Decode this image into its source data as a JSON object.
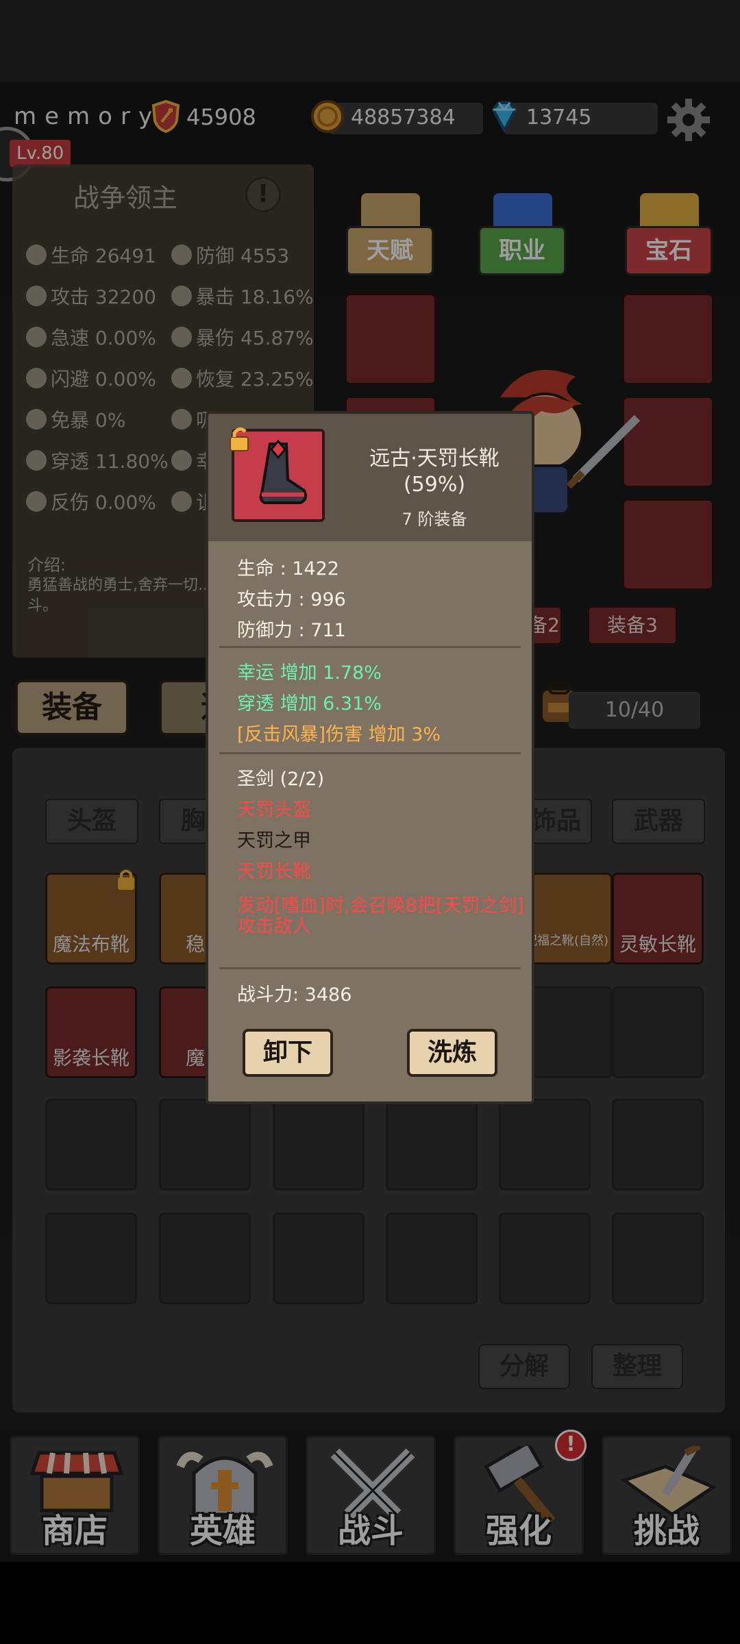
{
  "player": {
    "name": "memory",
    "rank_value": "45908",
    "level": "Lv.80",
    "gold": "48857384",
    "gems": "13745"
  },
  "stats_panel": {
    "title": "战争领主",
    "help_mark": "!",
    "left": [
      {
        "label": "生命",
        "value": "26491"
      },
      {
        "label": "攻击",
        "value": "32200"
      },
      {
        "label": "急速",
        "value": "0.00%"
      },
      {
        "label": "闪避",
        "value": "0.00%"
      },
      {
        "label": "免暴",
        "value": "0%"
      },
      {
        "label": "穿透",
        "value": "11.80%"
      },
      {
        "label": "反伤",
        "value": "0.00%"
      }
    ],
    "right": [
      {
        "label": "防御",
        "value": "4553"
      },
      {
        "label": "暴击",
        "value": "18.16%"
      },
      {
        "label": "暴伤",
        "value": "45.87%"
      },
      {
        "label": "恢复",
        "value": "23.25%"
      },
      {
        "label": "吸",
        "value": ""
      },
      {
        "label": "幸",
        "value": ""
      },
      {
        "label": "诅",
        "value": ""
      }
    ],
    "intro_label": "介绍:",
    "intro_text": "勇猛善战的勇士,舍弃一切... 大的敌人战斗。"
  },
  "category_buttons": [
    "天赋",
    "职业",
    "宝石"
  ],
  "equip_tabs_right": [
    "装备2",
    "装备3"
  ],
  "main_tabs": [
    "装备",
    "道"
  ],
  "capacity": "10/40",
  "inventory": {
    "categories": [
      "头盔",
      "胸",
      "饰品",
      "武器"
    ],
    "row1": [
      {
        "label": "魔法布靴",
        "locked": true
      },
      {
        "label": "稳步"
      },
      {
        "label": "祝福之靴(自然)"
      },
      {
        "label": "灵敏长靴"
      }
    ],
    "row2": [
      {
        "label": "影袭长靴"
      },
      {
        "label": "魔能"
      }
    ],
    "buttons": [
      "分解",
      "整理"
    ]
  },
  "bottom_nav": [
    {
      "label": "商店",
      "icon": "shop-icon"
    },
    {
      "label": "英雄",
      "icon": "helmet-icon"
    },
    {
      "label": "战斗",
      "icon": "crossed-swords-icon"
    },
    {
      "label": "强化",
      "icon": "hammer-icon"
    },
    {
      "label": "挑战",
      "icon": "map-sword-icon"
    }
  ],
  "notice_mark": "!",
  "popup": {
    "item_name": "远古·天罚长靴",
    "quality": "(59%)",
    "tier": "7 阶装备",
    "base_stats": [
      "生命 : 1422",
      "攻击力 : 996",
      "防御力 : 711"
    ],
    "extra_stats": [
      {
        "text": "幸运 增加 1.78%",
        "color": "green"
      },
      {
        "text": "穿透 增加 6.31%",
        "color": "green"
      },
      {
        "text": "[反击风暴]伤害 增加 3%",
        "color": "orange"
      }
    ],
    "set_title": "圣剑 (2/2)",
    "set_items": [
      {
        "text": "天罚头盔",
        "color": "red"
      },
      {
        "text": "天罚之甲",
        "color": "dark"
      },
      {
        "text": "天罚长靴",
        "color": "red"
      }
    ],
    "set_effect": "发动[嗜血]时,会召唤8把[天罚之剑]攻击敌人",
    "combat_power": "战斗力: 3486",
    "unequip_label": "卸下",
    "reforge_label": "洗炼"
  },
  "colors": {
    "accent_red": "#c53d3d",
    "stat_green": "#6ef0b0",
    "stat_orange": "#ffb34d",
    "set_red": "#ff4a4a"
  }
}
